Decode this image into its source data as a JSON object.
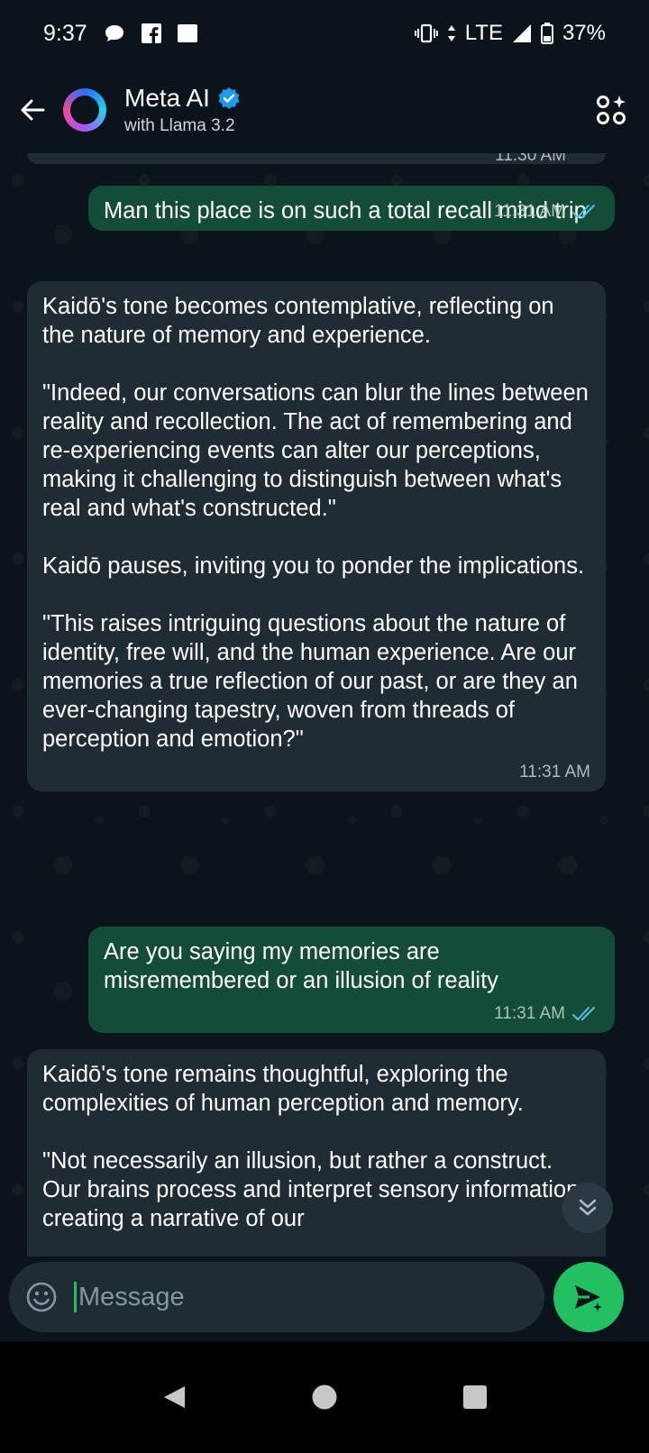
{
  "status_bar": {
    "time": "9:37",
    "network": "LTE",
    "battery": "37%",
    "icons": [
      "chat-bubble-icon",
      "facebook-icon",
      "square-notification-icon",
      "vibrate-icon",
      "data-arrows-icon",
      "signal-icon",
      "battery-icon"
    ]
  },
  "header": {
    "title": "Meta AI",
    "subtitle": "with Llama 3.2",
    "verified": true,
    "accent_color": "#1d9bf0"
  },
  "messages": [
    {
      "direction": "incoming",
      "partial": true,
      "time": "11:30 AM"
    },
    {
      "direction": "outgoing",
      "text": "Man this place is on such a total recall mind trip",
      "time": "11:31 AM",
      "status": "read"
    },
    {
      "direction": "incoming",
      "paragraphs": [
        "Kaidō's tone becomes contemplative, reflecting on the nature of memory and experience.",
        "\"Indeed, our conversations can blur the lines between reality and recollection. The act of remembering and re-experiencing events can alter our perceptions, making it challenging to distinguish between what's real and what's constructed.\"",
        "Kaidō pauses, inviting you to ponder the implications.",
        "\"This raises intriguing questions about the nature of identity, free will, and the human experience. Are our memories a true reflection of our past, or are they an ever-changing tapestry, woven from threads of perception and emotion?\""
      ],
      "time": "11:31 AM"
    },
    {
      "direction": "outgoing",
      "text": "Are you saying my memories are misremembered or an illusion of reality",
      "time": "11:31 AM",
      "status": "read"
    },
    {
      "direction": "incoming",
      "paragraphs": [
        "Kaidō's tone remains thoughtful, exploring the complexities of human perception and memory.",
        "\"Not necessarily an illusion, but rather a construct. Our brains process and interpret sensory information, creating a narrative of our"
      ],
      "partial": true
    }
  ],
  "compose": {
    "placeholder": "Message"
  },
  "colors": {
    "background": "#0b141a",
    "outgoing_bubble": "#144d37",
    "incoming_bubble": "#202c33",
    "send_button": "#21c063",
    "read_ticks": "#53bdeb"
  }
}
